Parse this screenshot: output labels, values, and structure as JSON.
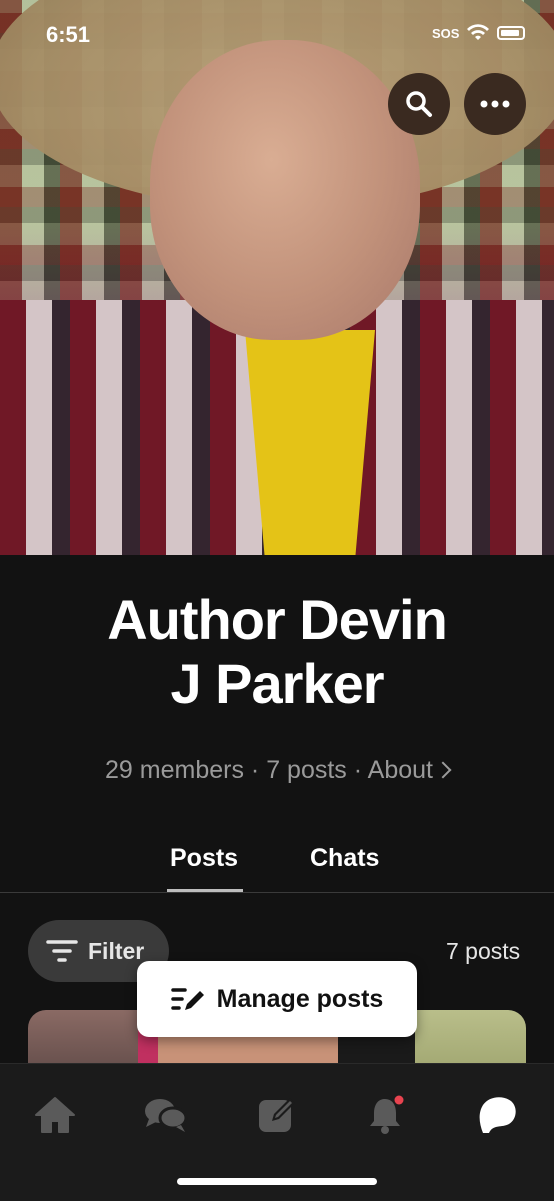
{
  "status_bar": {
    "time": "6:51",
    "carrier": "SOS"
  },
  "header": {
    "search_icon": "search-icon",
    "more_icon": "more-horizontal-icon"
  },
  "profile": {
    "name_line1": "Author Devin",
    "name_line2": "J Parker",
    "members": "29 members",
    "sep1": " · ",
    "posts": "7 posts",
    "sep2": " · ",
    "about": "About"
  },
  "tabs": [
    {
      "label": "Posts",
      "active": true
    },
    {
      "label": "Chats",
      "active": false
    }
  ],
  "toolbar": {
    "filter_label": "Filter",
    "post_count": "7 posts"
  },
  "manage_posts": {
    "label": "Manage posts"
  },
  "bottom_nav": [
    {
      "icon": "home-icon"
    },
    {
      "icon": "chats-icon"
    },
    {
      "icon": "compose-icon"
    },
    {
      "icon": "bell-icon",
      "badge": true
    },
    {
      "icon": "patreon-logo-icon",
      "active": true
    }
  ],
  "colors": {
    "background": "#121212",
    "badge": "#e8434f",
    "nav_background": "#1b1b1b"
  }
}
